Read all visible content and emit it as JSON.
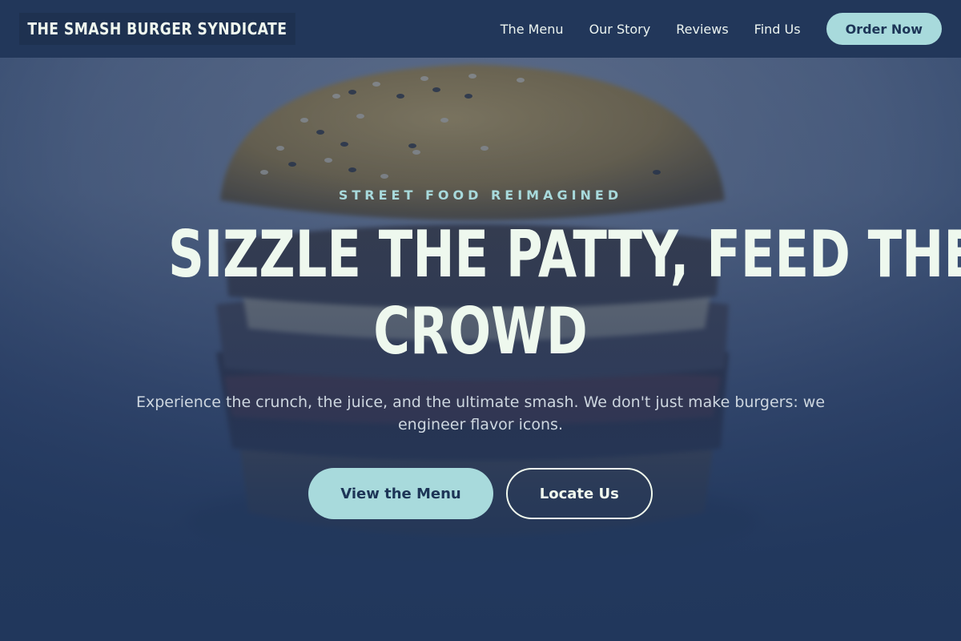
{
  "nav": {
    "brand": "THE SMASH BURGER SYNDICATE",
    "links": [
      "The Menu",
      "Our Story",
      "Reviews",
      "Find Us"
    ],
    "order_label": "Order Now"
  },
  "hero": {
    "eyebrow": "STREET FOOD REIMAGINED",
    "headline_line1": "SIZZLE THE PATTY, FEED THE",
    "headline_line2": "CROWD",
    "subtext": "Experience the crunch, the juice, and the ultimate smash. We don't just make burgers: we engineer flavor icons.",
    "primary_cta": "View the Menu",
    "secondary_cta": "Locate Us",
    "background_image": "burger-photo"
  },
  "colors": {
    "navy": "#1d3557",
    "accent": "#a8dadc",
    "cream": "#f1faee"
  }
}
